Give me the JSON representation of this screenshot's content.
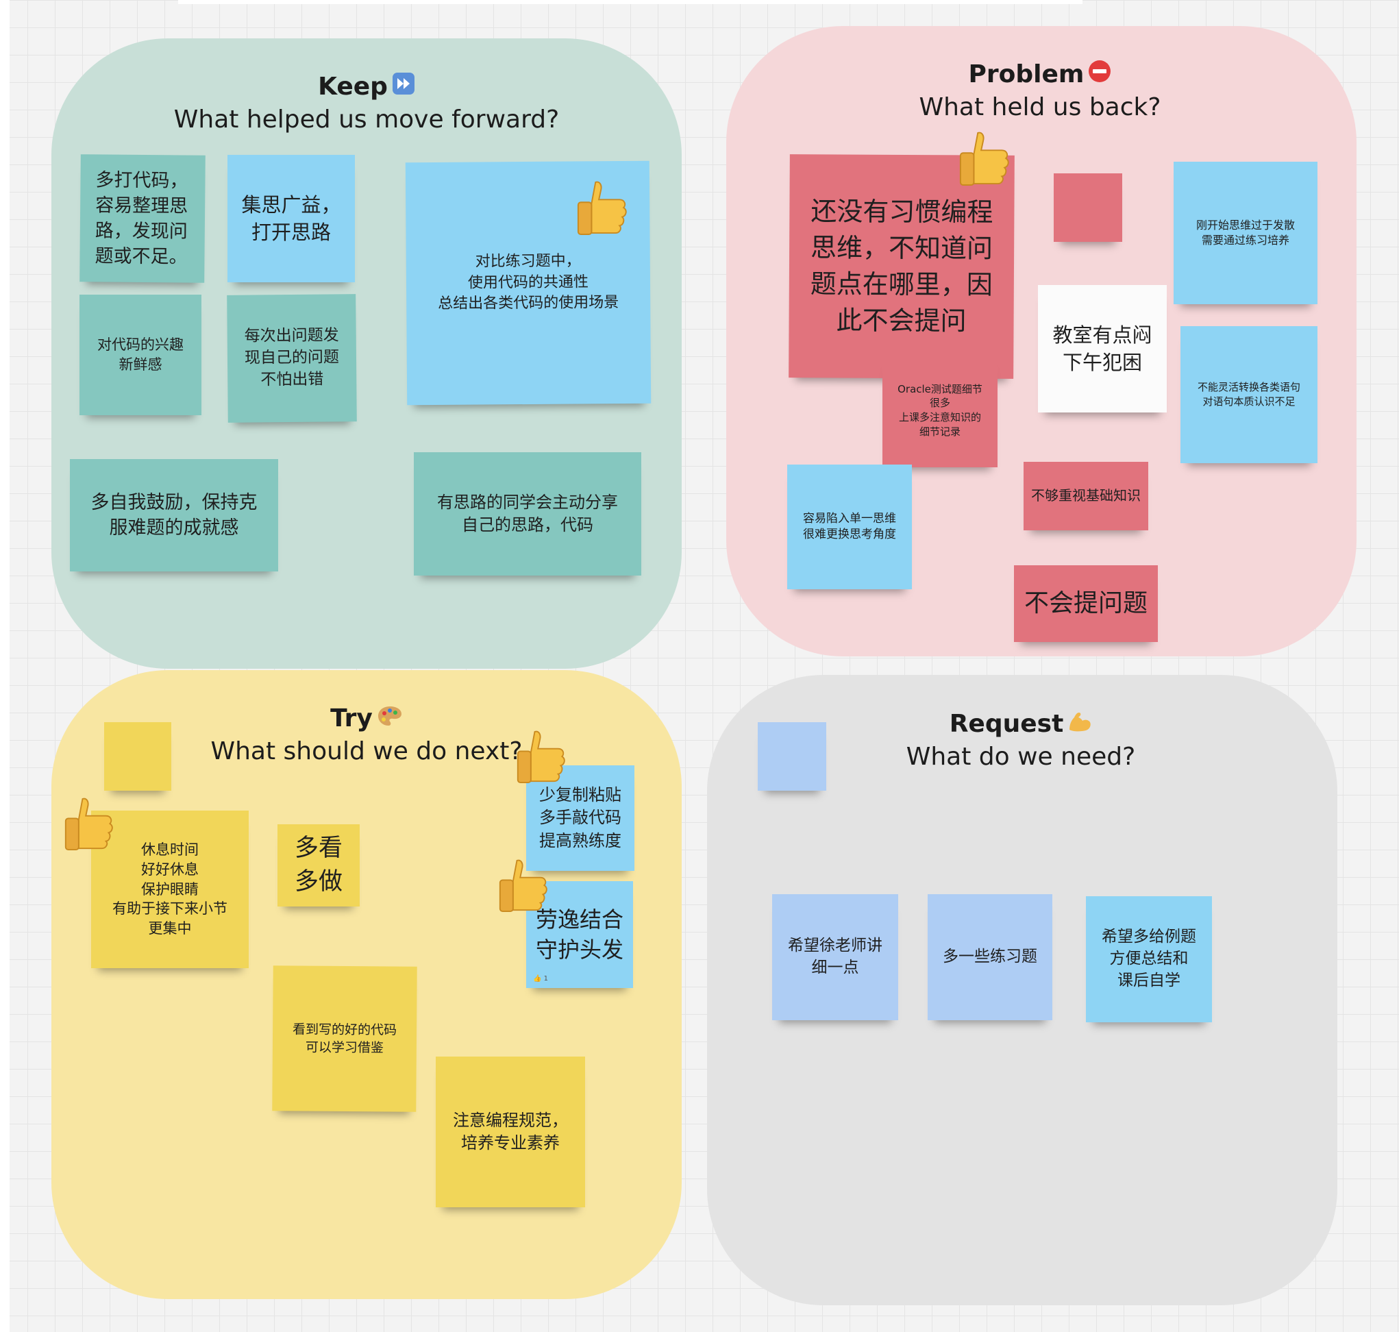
{
  "keep": {
    "title": "Keep",
    "subtitle": "What helped us move forward?",
    "title_icon": "fast-forward-icon",
    "notes": {
      "n1": "多打代码，\n容易整理思\n路，发现问\n题或不足。",
      "n2": "集思广益，\n打开思路",
      "n3": "对比练习题中，\n使用代码的共通性\n总结出各类代码的使用场景",
      "n4": "对代码的兴趣\n新鲜感",
      "n5": "每次出问题发\n现自己的问题\n不怕出错",
      "n6": "多自我鼓励，保持克\n服难题的成就感",
      "n7": "有思路的同学会主动分享\n自己的思路，代码"
    }
  },
  "problem": {
    "title": "Problem",
    "subtitle": "What held us back?",
    "title_icon": "no-entry-icon",
    "notes": {
      "n1": "还没有习惯编程\n思维，不知道问\n题点在哪里，因\n此不会提问",
      "n2": "",
      "n3": "刚开始思维过于发散\n需要通过练习培养",
      "n4": "教室有点闷\n下午犯困",
      "n5": "Oracle测试题细节\n很多\n上课多注意知识的\n细节记录",
      "n6": "不能灵活转换各类语句\n对语句本质认识不足",
      "n7": "不够重视基础知识",
      "n8": "容易陷入单一思维\n很难更换思考角度",
      "n9": "不会提问题"
    }
  },
  "try": {
    "title": "Try",
    "subtitle": "What should we do next?",
    "title_icon": "palette-icon",
    "notes": {
      "n1": "",
      "n2": "休息时间\n好好休息\n保护眼睛\n有助于接下来小节\n更集中",
      "n3": "多看\n多做",
      "n4": "少复制粘贴\n多手敲代码\n提高熟练度",
      "n5": "劳逸结合\n守护头发",
      "n6": "看到写的好的代码\n可以学习借鉴",
      "n7": "注意编程规范，\n培养专业素养"
    },
    "reaction_count": "1"
  },
  "request": {
    "title": "Request",
    "subtitle": "What do we need?",
    "title_icon": "flexed-biceps-icon",
    "notes": {
      "n1": "",
      "n2": "希望徐老师讲\n细一点",
      "n3": "多一些练习题",
      "n4": "希望多给例题\n方便总结和\n课后自学"
    }
  },
  "colors": {
    "keep_bg": "#c8dfd7",
    "problem_bg": "#f5d7d9",
    "try_bg": "#f8e6a2",
    "request_bg": "#e3e3e3",
    "teal_note": "#85c7bf",
    "blue_note": "#8ed4f4",
    "red_note": "#e1737d",
    "yellow_note": "#f1d659",
    "light_blue_note": "#aecdf4"
  },
  "reaction_icon": "thumbs-up-icon"
}
